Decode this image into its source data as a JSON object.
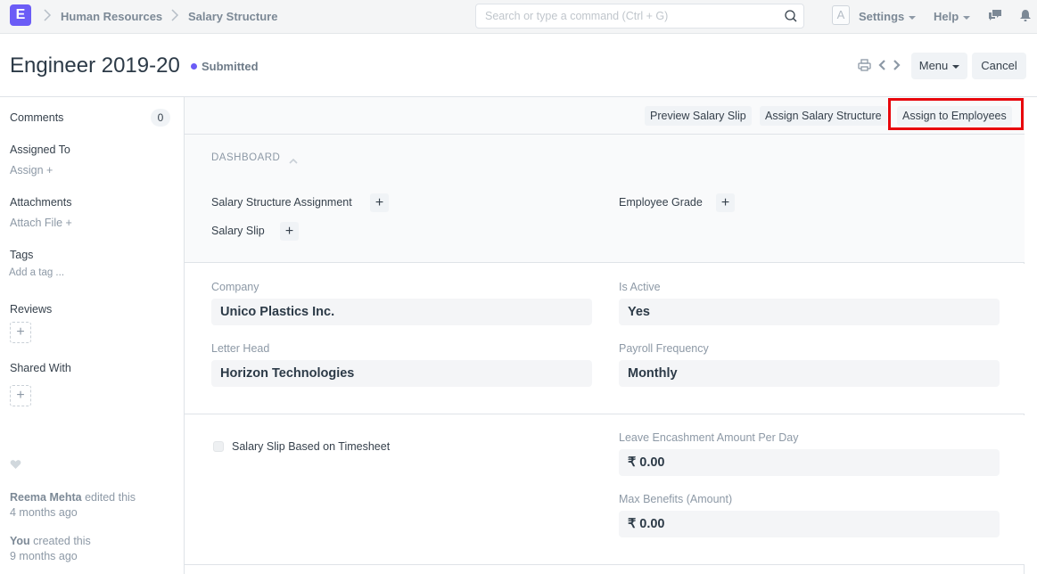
{
  "navbar": {
    "logo_letter": "E",
    "breadcrumbs": [
      "Human Resources",
      "Salary Structure"
    ],
    "search_placeholder": "Search or type a command (Ctrl + G)",
    "avatar_letter": "A",
    "settings_label": "Settings",
    "help_label": "Help"
  },
  "page": {
    "title": "Engineer 2019-20",
    "status": "Submitted",
    "status_color": "#6b5cf6",
    "menu_label": "Menu",
    "cancel_label": "Cancel"
  },
  "sidebar": {
    "comments_label": "Comments",
    "comments_count": "0",
    "assigned_to_label": "Assigned To",
    "assign_link": "Assign",
    "attachments_label": "Attachments",
    "attach_link": "Attach File",
    "tags_label": "Tags",
    "add_tag_link": "Add a tag ...",
    "reviews_label": "Reviews",
    "shared_with_label": "Shared With",
    "activity": [
      {
        "user": "Reema Mehta",
        "action": "edited this",
        "time": "4 months ago"
      },
      {
        "user": "You",
        "action": "created this",
        "time": "9 months ago"
      }
    ]
  },
  "actions": {
    "preview": "Preview Salary Slip",
    "assign_structure": "Assign Salary Structure",
    "assign_employees": "Assign to Employees",
    "highlight_color": "#e8060c"
  },
  "dashboard": {
    "title": "DASHBOARD",
    "links": [
      "Salary Structure Assignment",
      "Salary Slip",
      "Employee Grade"
    ]
  },
  "fields": {
    "company": {
      "label": "Company",
      "value": "Unico Plastics Inc."
    },
    "letter_head": {
      "label": "Letter Head",
      "value": "Horizon Technologies"
    },
    "is_active": {
      "label": "Is Active",
      "value": "Yes"
    },
    "payroll_frequency": {
      "label": "Payroll Frequency",
      "value": "Monthly"
    },
    "timesheet_checkbox": {
      "label": "Salary Slip Based on Timesheet",
      "checked": false
    },
    "leave_encashment": {
      "label": "Leave Encashment Amount Per Day",
      "value": "₹ 0.00"
    },
    "max_benefits": {
      "label": "Max Benefits (Amount)",
      "value": "₹ 0.00"
    }
  }
}
